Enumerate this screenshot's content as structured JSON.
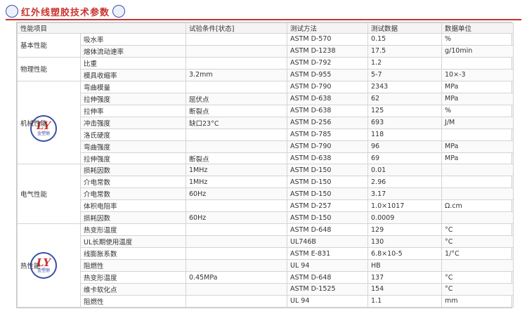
{
  "title": "红外线塑胶技术参数",
  "logo": {
    "monogram": "LY",
    "name": "金塑丽"
  },
  "headers": [
    "性能项目",
    "",
    "试验条件[状态]",
    "测试方法",
    "测试数据",
    "数据单位"
  ],
  "categories": [
    {
      "name": "基本性能",
      "rows": [
        {
          "item": "吸水率",
          "condition": "",
          "method": "ASTM D-570",
          "value": "0.15",
          "unit": "%"
        },
        {
          "item": "熔体流动速率",
          "condition": "",
          "method": "ASTM D-1238",
          "value": "17.5",
          "unit": "g/10min"
        }
      ]
    },
    {
      "name": "物理性能",
      "rows": [
        {
          "item": "比重",
          "condition": "",
          "method": "ASTM D-792",
          "value": "1.2",
          "unit": ""
        },
        {
          "item": "模具收缩率",
          "condition": "3.2mm",
          "method": "ASTM D-955",
          "value": "5-7",
          "unit": "10×-3"
        }
      ]
    },
    {
      "name": "机械性能",
      "rows": [
        {
          "item": "弯曲模量",
          "condition": "",
          "method": "ASTM D-790",
          "value": "2343",
          "unit": "MPa"
        },
        {
          "item": "拉伸强度",
          "condition": "屈伏点",
          "method": "ASTM D-638",
          "value": "62",
          "unit": "MPa"
        },
        {
          "item": "拉伸率",
          "condition": "断裂点",
          "method": "ASTM D-638",
          "value": "125",
          "unit": "%"
        },
        {
          "item": "冲击强度",
          "condition": "缺口23°C",
          "method": "ASTM D-256",
          "value": "693",
          "unit": "J/M"
        },
        {
          "item": "洛氏硬度",
          "condition": "",
          "method": "ASTM D-785",
          "value": "118",
          "unit": ""
        },
        {
          "item": "弯曲强度",
          "condition": "",
          "method": "ASTM D-790",
          "value": "96",
          "unit": "MPa"
        },
        {
          "item": "拉伸强度",
          "condition": "断裂点",
          "method": "ASTM D-638",
          "value": "69",
          "unit": "MPa"
        }
      ]
    },
    {
      "name": "电气性能",
      "rows": [
        {
          "item": "损耗因数",
          "condition": "1MHz",
          "method": "ASTM D-150",
          "value": "0.01",
          "unit": ""
        },
        {
          "item": "介电常数",
          "condition": "1MHz",
          "method": "ASTM D-150",
          "value": "2.96",
          "unit": ""
        },
        {
          "item": "介电常数",
          "condition": "60Hz",
          "method": "ASTM D-150",
          "value": "3.17",
          "unit": ""
        },
        {
          "item": "体积电阻率",
          "condition": "",
          "method": "ASTM D-257",
          "value": "1.0×1017",
          "unit": "Ω.cm"
        },
        {
          "item": "损耗因数",
          "condition": "60Hz",
          "method": "ASTM D-150",
          "value": "0.0009",
          "unit": ""
        }
      ]
    },
    {
      "name": "热性能",
      "rows": [
        {
          "item": "热变形温度",
          "condition": "",
          "method": "ASTM D-648",
          "value": "129",
          "unit": "°C"
        },
        {
          "item": "UL长期使用温度",
          "condition": "",
          "method": "UL746B",
          "value": "130",
          "unit": "°C"
        },
        {
          "item": "线膨胀系数",
          "condition": "",
          "method": "ASTM E-831",
          "value": "6.8×10-5",
          "unit": "1/°C"
        },
        {
          "item": "阻燃性",
          "condition": "",
          "method": "UL 94",
          "value": "HB",
          "unit": ""
        },
        {
          "item": "热变形温度",
          "condition": "0.45MPa",
          "method": "ASTM D-648",
          "value": "137",
          "unit": "°C"
        },
        {
          "item": "维卡软化点",
          "condition": "",
          "method": "ASTM D-1525",
          "value": "154",
          "unit": "°C"
        },
        {
          "item": "阻燃性",
          "condition": "",
          "method": "UL 94",
          "value": "1.1",
          "unit": "mm"
        }
      ]
    }
  ]
}
